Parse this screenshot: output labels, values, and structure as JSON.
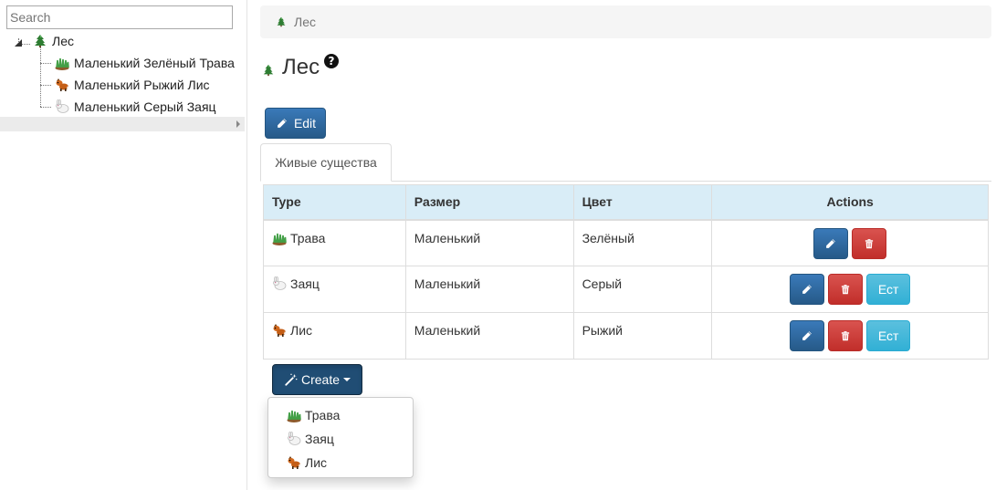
{
  "sidebar": {
    "search_placeholder": "Search",
    "root": {
      "label": "Лес",
      "icon": "tree-icon"
    },
    "children": [
      {
        "label": "Маленький Зелёный Трава",
        "icon": "grass-icon"
      },
      {
        "label": "Маленький Рыжий Лис",
        "icon": "fox-icon"
      },
      {
        "label": "Маленький Серый Заяц",
        "icon": "hare-icon"
      }
    ]
  },
  "breadcrumb": {
    "label": "Лес",
    "icon": "tree-icon"
  },
  "page": {
    "title": "Лес",
    "title_icon": "tree-icon",
    "help_icon": "question-circle-icon"
  },
  "toolbar": {
    "edit_label": "Edit",
    "edit_icon": "pencil-icon"
  },
  "tabs": [
    {
      "label": "Живые существа"
    }
  ],
  "table": {
    "headers": [
      "Type",
      "Размер",
      "Цвет",
      "Actions"
    ],
    "rows": [
      {
        "type": "Трава",
        "icon": "grass-icon",
        "size": "Маленький",
        "color": "Зелёный",
        "actions": [
          "edit",
          "delete"
        ]
      },
      {
        "type": "Заяц",
        "icon": "hare-icon",
        "size": "Маленький",
        "color": "Серый",
        "actions": [
          "edit",
          "delete",
          "eat"
        ]
      },
      {
        "type": "Лис",
        "icon": "fox-icon",
        "size": "Маленький",
        "color": "Рыжий",
        "actions": [
          "edit",
          "delete",
          "eat"
        ]
      }
    ],
    "eat_label": "Ест"
  },
  "create": {
    "label": "Create",
    "icon": "magic-wand-icon",
    "menu": [
      {
        "label": "Трава",
        "icon": "grass-icon"
      },
      {
        "label": "Заяц",
        "icon": "hare-icon"
      },
      {
        "label": "Лис",
        "icon": "fox-icon"
      }
    ]
  },
  "colors": {
    "primary": "#286090",
    "danger": "#d9534f",
    "info": "#5bc0de",
    "table_header": "#d9edf7",
    "breadcrumb_bg": "#f5f5f5"
  }
}
